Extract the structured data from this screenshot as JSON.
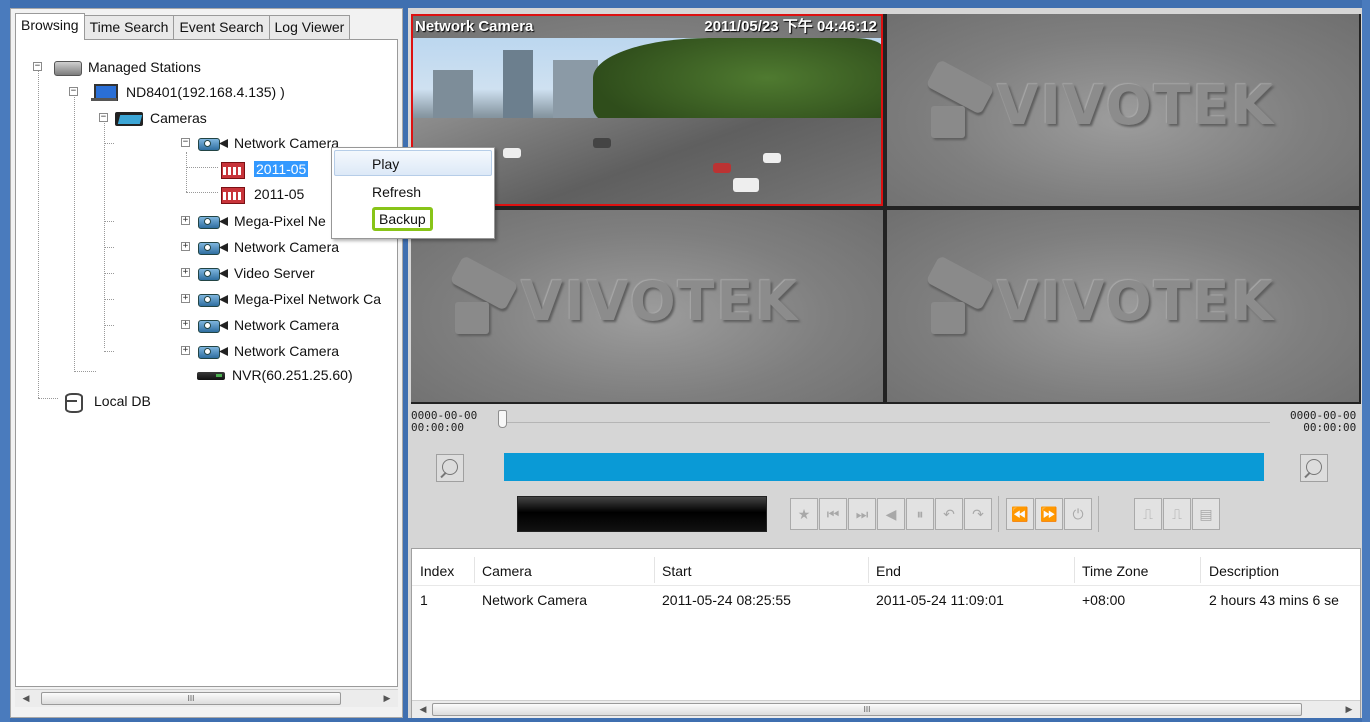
{
  "tabs": [
    "Browsing",
    "Time Search",
    "Event Search",
    "Log Viewer"
  ],
  "tree": {
    "managed_stations": "Managed Stations",
    "station": "ND8401(192.168.4.135) )",
    "cameras": "Cameras",
    "network_camera": "Network Camera",
    "recording_1": "2011-05",
    "recording_2": "2011-05",
    "mega_pixel_1": "Mega-Pixel Ne",
    "network_camera_2": "Network Camera",
    "video_server": "Video Server",
    "mega_pixel_2": "Mega-Pixel Network Ca",
    "network_camera_3": "Network Camera",
    "network_camera_4": "Network Camera",
    "nvr": "NVR(60.251.25.60)",
    "local_db": "Local DB"
  },
  "context_menu": [
    "Play",
    "Refresh",
    "Backup"
  ],
  "video": {
    "camera_title": "Network Camera",
    "timestamp": "2011/05/23 下午 04:46:12",
    "watermark": "VIVOTEK"
  },
  "timeline": {
    "start_date": "0000-00-00",
    "start_time": "00:00:00",
    "end_date": "0000-00-00",
    "end_time": "00:00:00"
  },
  "controls": [
    "★",
    "⏮",
    "⏭",
    "◀",
    "⏸",
    "↶",
    "↷",
    "⏪",
    "⏩",
    "⏻",
    "⎍",
    "⎍",
    "▤"
  ],
  "table": {
    "columns": [
      "Index",
      "Camera",
      "Start",
      "End",
      "Time Zone",
      "Description"
    ],
    "rows": [
      [
        "1",
        "Network Camera",
        "2011-05-24 08:25:55",
        "2011-05-24 11:09:01",
        "+08:00",
        "2 hours 43 mins 6 se"
      ]
    ]
  },
  "scrollbar_grip": "III",
  "colors": {
    "selection": "#3399ff",
    "timeline_bar": "#0a9ad6",
    "highlight_box": "#88c418",
    "active_cell_border": "#dd1111"
  }
}
